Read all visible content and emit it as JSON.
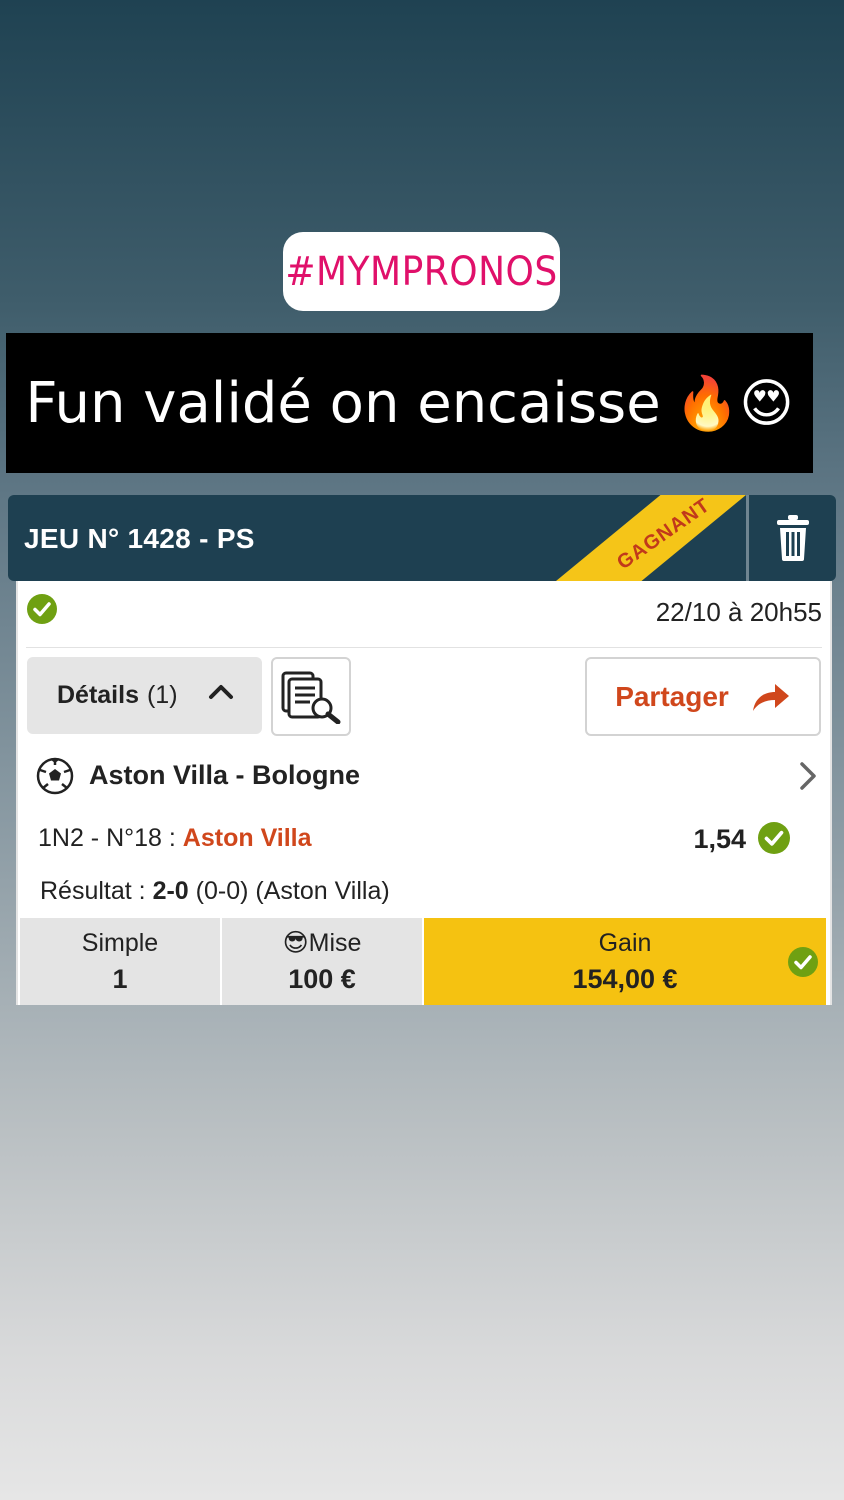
{
  "story": {
    "hashtag": "#MYMPRONOS",
    "caption": "Fun validé on encaisse",
    "caption_emojis": "🔥😍"
  },
  "bet": {
    "title": "JEU N° 1428 - PS",
    "ribbon": "GAGNANT",
    "date": "22/10 à 20h55",
    "details_label": "Détails",
    "details_count": "(1)",
    "share_label": "Partager",
    "match": "Aston Villa - Bologne",
    "pick_label": "1N2 - N°18 :",
    "pick_team": "Aston Villa",
    "odds": "1,54",
    "result_label": "Résultat :",
    "result_score": "2-0",
    "result_extra": "(0-0) (Aston Villa)",
    "footer": {
      "type_label": "Simple",
      "type_value": "1",
      "stake_label": "😎Mise",
      "stake_value": "100 €",
      "gain_label": "Gain",
      "gain_value": "154,00 €"
    }
  },
  "colors": {
    "header_bg": "#1e4051",
    "accent_orange": "#d0471c",
    "ribbon_yellow": "#f5c518",
    "gain_yellow": "#f5c211",
    "success_green": "#6fa012",
    "hashtag_pink": "#e0106a"
  },
  "icons": [
    "trash-icon",
    "check-circle-icon",
    "chevron-up-icon",
    "document-search-icon",
    "share-arrow-icon",
    "soccer-ball-icon",
    "chevron-right-icon"
  ]
}
